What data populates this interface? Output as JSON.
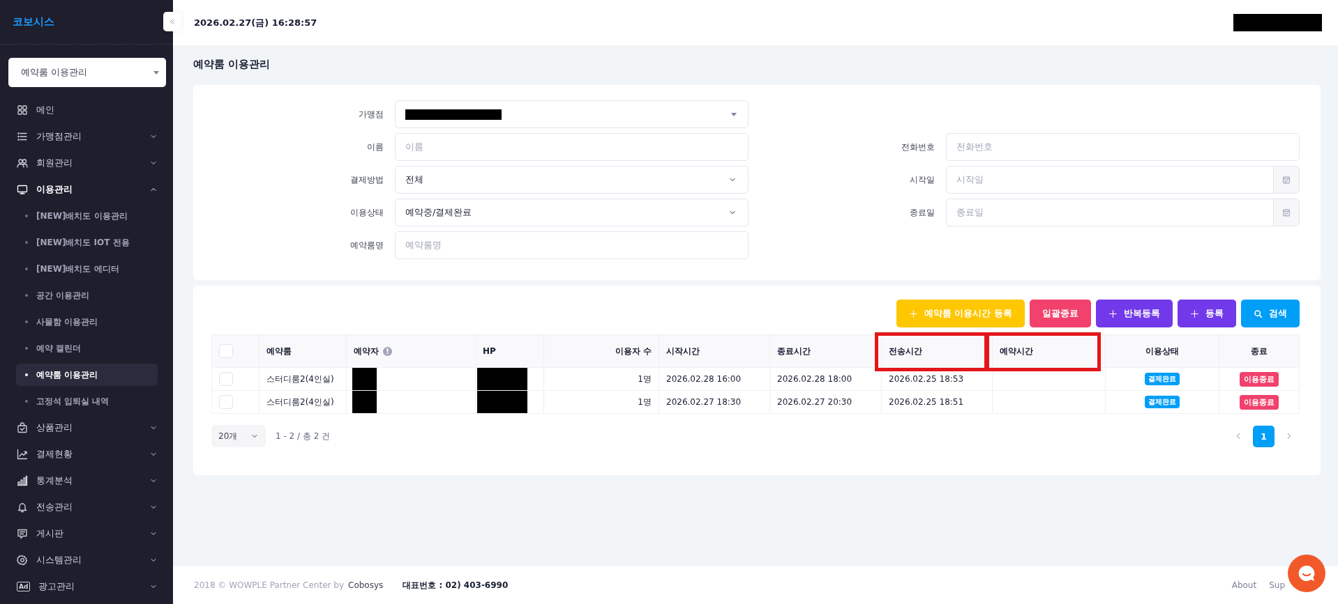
{
  "sidebar": {
    "logo": "코보시스",
    "selector": {
      "value": "예약룸 이용관리"
    },
    "items": [
      {
        "label": "메인",
        "kind": "grid",
        "expandable": false,
        "expanded": false
      },
      {
        "label": "가맹점관리",
        "kind": "list",
        "expandable": true,
        "expanded": false
      },
      {
        "label": "회원관리",
        "kind": "users",
        "expandable": true,
        "expanded": false
      },
      {
        "label": "이용관리",
        "kind": "monitor",
        "expandable": true,
        "expanded": true,
        "children": [
          {
            "label": "[NEW]배치도 이용관리",
            "selected": false
          },
          {
            "label": "[NEW]배치도 IOT 전용",
            "selected": false
          },
          {
            "label": "[NEW]배치도 에디터",
            "selected": false
          },
          {
            "label": "공간 이용관리",
            "selected": false
          },
          {
            "label": "사물함 이용관리",
            "selected": false
          },
          {
            "label": "예약 캘린더",
            "selected": false
          },
          {
            "label": "예약룸 이용관리",
            "selected": true
          },
          {
            "label": "고정석 입퇴실 내역",
            "selected": false
          }
        ]
      },
      {
        "label": "상품관리",
        "kind": "bag",
        "expandable": true,
        "expanded": false
      },
      {
        "label": "결제현황",
        "kind": "trend",
        "expandable": true,
        "expanded": false
      },
      {
        "label": "통계분석",
        "kind": "bars",
        "expandable": true,
        "expanded": false
      },
      {
        "label": "전송관리",
        "kind": "bell",
        "expandable": true,
        "expanded": false
      },
      {
        "label": "게시판",
        "kind": "chat",
        "expandable": true,
        "expanded": false
      },
      {
        "label": "시스템관리",
        "kind": "gear",
        "expandable": true,
        "expanded": false
      },
      {
        "label": "광고관리",
        "kind": "text",
        "icon_text": "Ad",
        "expandable": true,
        "expanded": false
      }
    ]
  },
  "header": {
    "datetime": "2026.02.27(금) 16:28:57",
    "user_redacted": true
  },
  "page_title": "예약룸 이용관리",
  "filter_rows": [
    {
      "left": {
        "label": "가맹점",
        "kind": "select",
        "redacted": true
      }
    },
    {
      "left": {
        "label": "이름",
        "kind": "input",
        "placeholder": "이름"
      },
      "right": {
        "label": "전화번호",
        "kind": "input",
        "placeholder": "전화번호"
      }
    },
    {
      "left": {
        "label": "결제방법",
        "kind": "dropdown",
        "value": "전체"
      },
      "right": {
        "label": "시작일",
        "kind": "date",
        "placeholder": "시작일"
      }
    },
    {
      "left": {
        "label": "이용상태",
        "kind": "dropdown",
        "value": "예약중/결제완료"
      },
      "right": {
        "label": "종료일",
        "kind": "date",
        "placeholder": "종료일"
      }
    },
    {
      "left": {
        "label": "예약룸명",
        "kind": "input",
        "placeholder": "예약룸명"
      }
    }
  ],
  "buttons": [
    {
      "label": "예약룸 이용시간 등록",
      "kind": "plus",
      "color": "#ffc700"
    },
    {
      "label": "일괄종료",
      "kind": "plain",
      "color": "#f1416c"
    },
    {
      "label": "반복등록",
      "kind": "plus",
      "color": "#7239ea"
    },
    {
      "label": "등록",
      "kind": "plus",
      "color": "#7239ea"
    },
    {
      "label": "검색",
      "kind": "search",
      "color": "#009ef7"
    }
  ],
  "table": {
    "all_checked": false,
    "columns": [
      {
        "label": "예약룸",
        "info": false,
        "highlighted": false
      },
      {
        "label": "예약자",
        "info": true,
        "highlighted": false
      },
      {
        "label": "HP",
        "info": false,
        "highlighted": false
      },
      {
        "label": "이용자 수",
        "info": false,
        "highlighted": false
      },
      {
        "label": "시작시간",
        "info": false,
        "highlighted": false
      },
      {
        "label": "종료시간",
        "info": false,
        "highlighted": false
      },
      {
        "label": "전송시간",
        "info": false,
        "highlighted": true
      },
      {
        "label": "예약시간",
        "info": false,
        "highlighted": true
      },
      {
        "label": "이용상태",
        "info": false,
        "highlighted": false
      },
      {
        "label": "종료",
        "info": false,
        "highlighted": false
      }
    ],
    "rows": [
      {
        "checked": false,
        "room": "스터디룸2(4인실)",
        "reserver_redacted": true,
        "hp_redacted": true,
        "users": "1명",
        "start": "2026.02.28 16:00",
        "end": "2026.02.28 18:00",
        "sent": "2026.02.25 18:53",
        "status": {
          "label": "결제완료",
          "color": "#009ef7"
        },
        "end_action": {
          "label": "이용종료",
          "color": "#f1416c"
        }
      },
      {
        "checked": false,
        "room": "스터디룸2(4인실)",
        "reserver_redacted": true,
        "hp_redacted": true,
        "users": "1명",
        "start": "2026.02.27 18:30",
        "end": "2026.02.27 20:30",
        "sent": "2026.02.25 18:51",
        "status": {
          "label": "결제완료",
          "color": "#009ef7"
        },
        "end_action": {
          "label": "이용종료",
          "color": "#f1416c"
        }
      }
    ]
  },
  "pagination": {
    "page_size": "20개",
    "summary": "1 - 2 / 총 2 건",
    "pages": [
      {
        "label": "1",
        "selected": true
      }
    ]
  },
  "footer": {
    "copyright": "2018 © WOWPLE Partner Center by",
    "company": "Cobosys",
    "phone": "대표번호 : 02) 403-6990",
    "links": [
      "About",
      "Sup"
    ]
  }
}
